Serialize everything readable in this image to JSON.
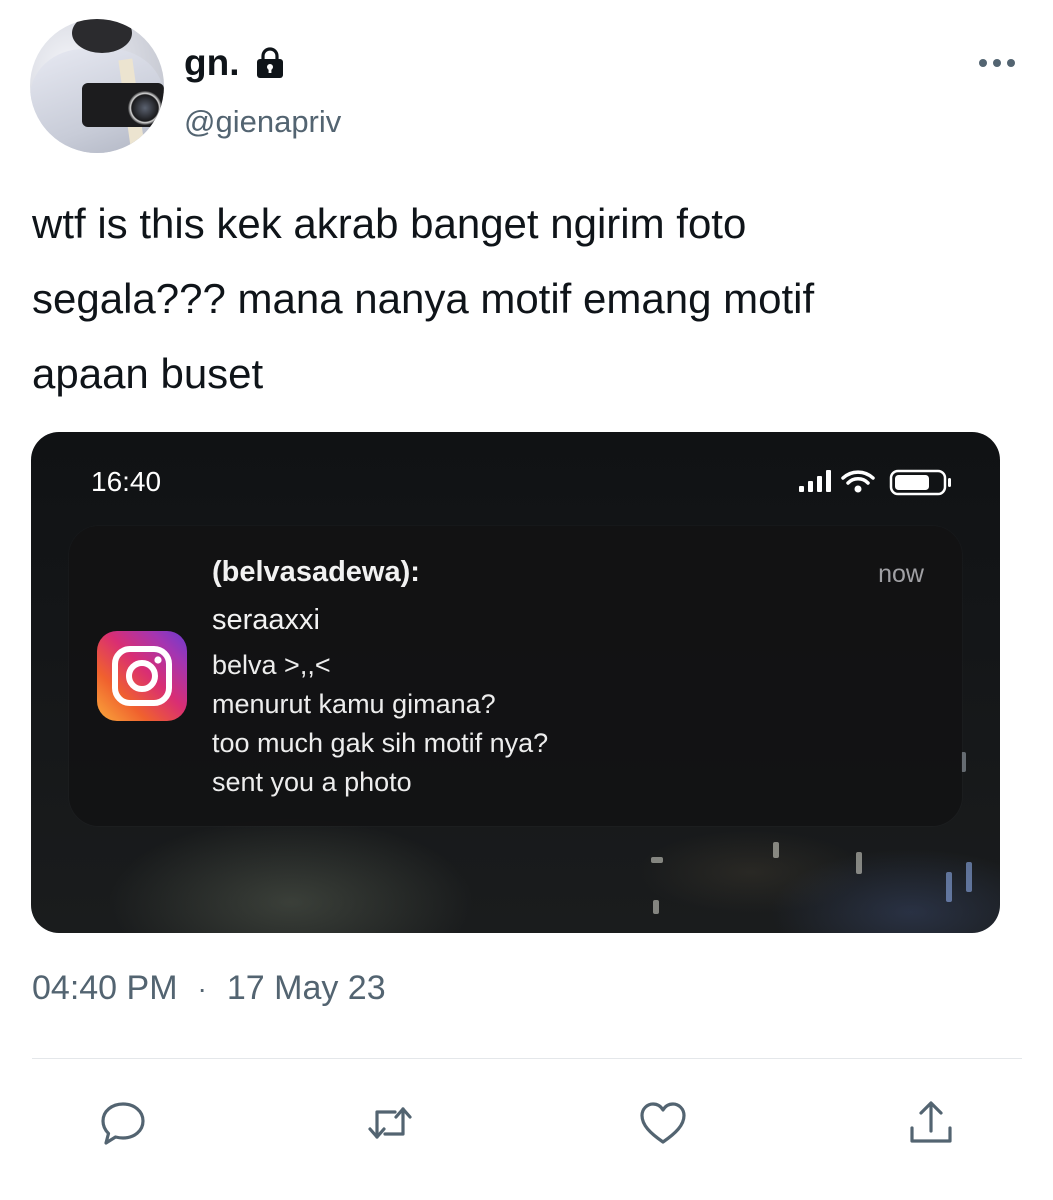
{
  "author": {
    "display_name": "gn.",
    "handle": "@gienapriv",
    "protected_icon": "lock-icon",
    "avatar": "profile-photo"
  },
  "tweet": {
    "text": "wtf is this kek akrab banget ngirim foto\nsegala??? mana nanya motif emang motif\napaan buset",
    "time": "04:40 PM",
    "separator": "·",
    "date": "17 May 23"
  },
  "media": {
    "status_bar": {
      "time": "16:40",
      "icons": [
        "cellular-signal-icon",
        "wifi-icon",
        "battery-icon"
      ]
    },
    "notification": {
      "app_icon": "instagram-icon",
      "sender": "(belvasadewa):",
      "timestamp": "now",
      "username": "seraaxxi",
      "lines": [
        "belva >,,<",
        "menurut kamu gimana?",
        "too much gak sih motif nya?",
        "sent you a photo"
      ]
    }
  },
  "actions": [
    "reply-icon",
    "retweet-icon",
    "like-icon",
    "share-icon"
  ],
  "colors": {
    "text_primary": "#0f1419",
    "text_secondary": "#536471",
    "divider": "#e4e7ea"
  }
}
